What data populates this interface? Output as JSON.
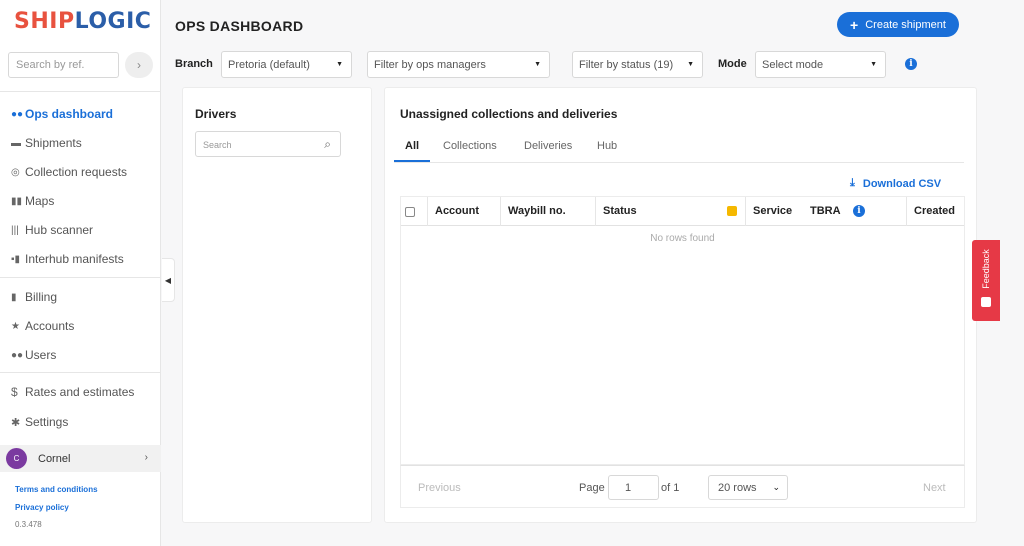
{
  "brand": {
    "part1": "SHIP",
    "part2": "LOGIC"
  },
  "sidebar": {
    "search_placeholder": "Search by ref.",
    "search_go_icon": "chevron-right-icon",
    "items": [
      {
        "label": "Ops dashboard",
        "icon": "users-icon",
        "active": true
      },
      {
        "label": "Shipments",
        "icon": "truck-icon"
      },
      {
        "label": "Collection requests",
        "icon": "target-icon"
      },
      {
        "label": "Maps",
        "icon": "map-icon"
      },
      {
        "label": "Hub scanner",
        "icon": "barcode-icon"
      },
      {
        "label": "Interhub manifests",
        "icon": "manifest-icon"
      },
      {
        "label": "Billing",
        "icon": "document-icon"
      },
      {
        "label": "Accounts",
        "icon": "star-icon"
      },
      {
        "label": "Users",
        "icon": "users-icon"
      },
      {
        "label": "Rates and estimates",
        "icon": "dollar-icon"
      },
      {
        "label": "Settings",
        "icon": "gear-icon"
      }
    ],
    "user": {
      "initial": "C",
      "name": "Cornel"
    },
    "links": {
      "terms": "Terms and conditions",
      "privacy": "Privacy policy"
    },
    "version": "0.3.478"
  },
  "header": {
    "title": "OPS DASHBOARD",
    "create_button": "Create shipment"
  },
  "filters": {
    "branch_label": "Branch",
    "branch_value": "Pretoria (default)",
    "ops_managers_placeholder": "Filter by ops managers",
    "status_value": "Filter by status",
    "status_count": "(19)",
    "mode_label": "Mode",
    "mode_placeholder": "Select mode"
  },
  "drivers": {
    "title": "Drivers",
    "search_placeholder": "Search"
  },
  "unassigned": {
    "title": "Unassigned collections and deliveries",
    "tabs": [
      "All",
      "Collections",
      "Deliveries",
      "Hub"
    ],
    "active_tab": "All",
    "download_label": "Download CSV",
    "columns": [
      "Account",
      "Waybill no.",
      "Status",
      "Service",
      "TBRA",
      "Created"
    ],
    "empty_message": "No rows found"
  },
  "pagination": {
    "previous": "Previous",
    "page_label": "Page",
    "page_value": "1",
    "of_label": "of 1",
    "rows_value": "20 rows",
    "next": "Next"
  },
  "feedback": {
    "label": "Feedback"
  },
  "colors": {
    "accent": "#1a6fd8",
    "brand_red": "#e8523f",
    "brand_blue": "#2b5ea8",
    "feedback": "#e63946"
  }
}
